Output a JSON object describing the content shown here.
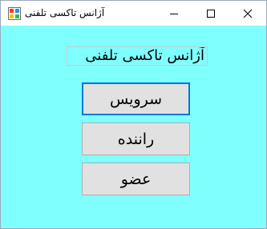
{
  "window": {
    "title": "آژانس تاکسی تلفنی",
    "icon": "windows-form-icon",
    "controls": {
      "minimize_icon": "minimize-icon",
      "maximize_icon": "maximize-icon",
      "close_icon": "close-icon"
    }
  },
  "form": {
    "heading": "آژانس تاکسی تلفنی",
    "buttons": {
      "service": "سرویس",
      "driver": "راننده",
      "member": "عضو"
    }
  },
  "colors": {
    "client_background": "#80ffff",
    "button_background": "#e1e1e1",
    "focus_border": "#0078d7"
  }
}
